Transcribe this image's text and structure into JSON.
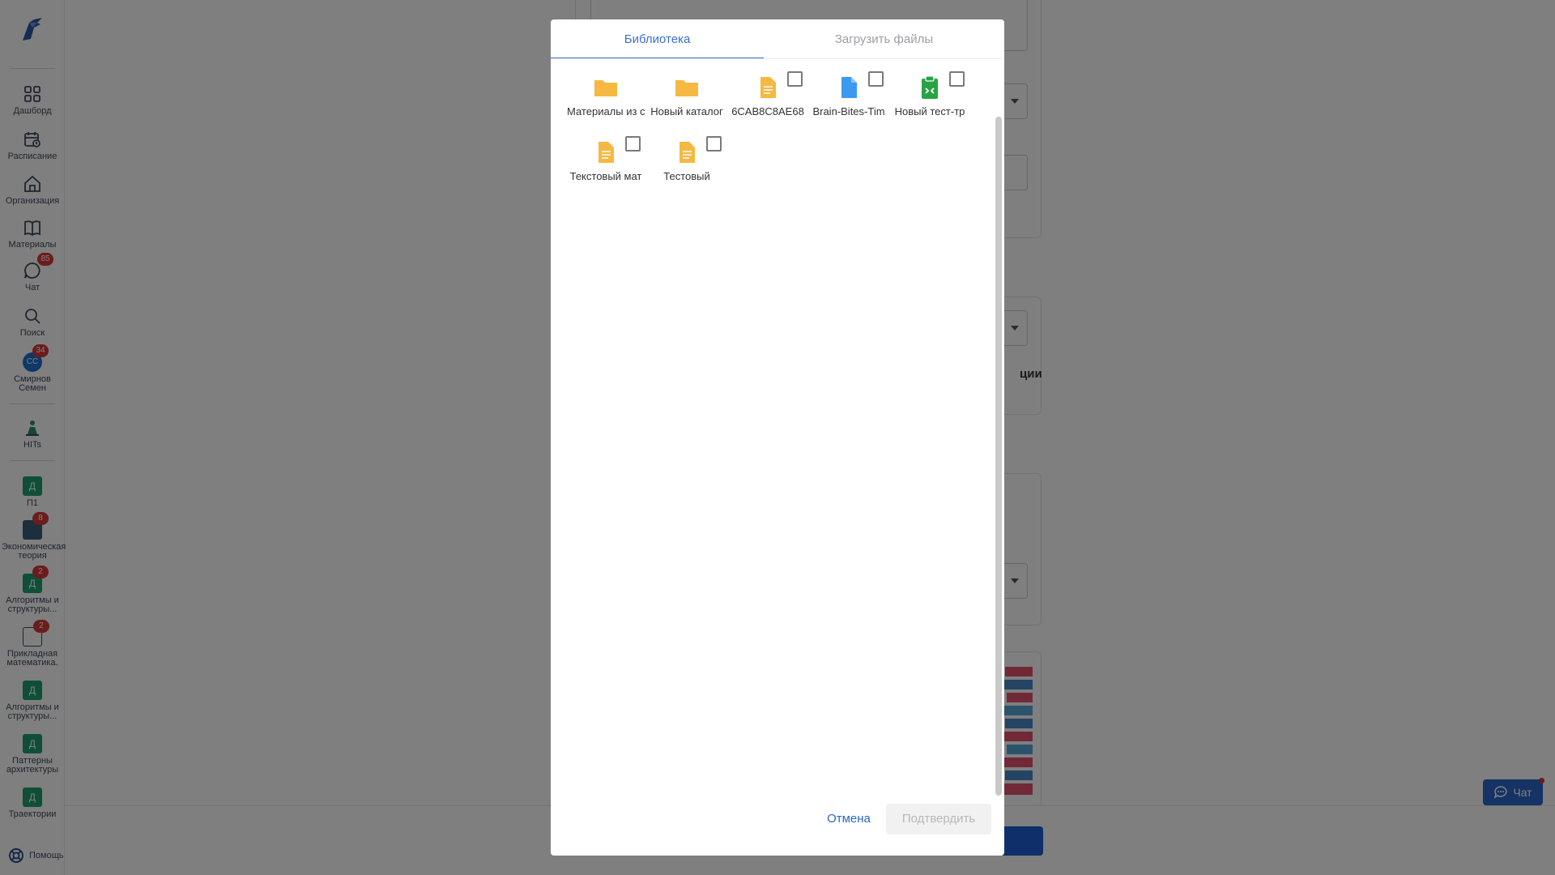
{
  "sidebar": {
    "nav": [
      {
        "label": "Дашборд",
        "icon": "dashboard-icon"
      },
      {
        "label": "Расписание",
        "icon": "calendar-icon"
      },
      {
        "label": "Организация",
        "icon": "home-icon"
      },
      {
        "label": "Материалы",
        "icon": "book-icon"
      },
      {
        "label": "Чат",
        "icon": "chat-icon",
        "badge": "85"
      },
      {
        "label": "Поиск",
        "icon": "search-icon"
      },
      {
        "label": "Смирнов Семен",
        "icon": "avatar",
        "avatar_text": "СС",
        "badge": "34"
      },
      {
        "label": "HITs",
        "icon": "hits-icon"
      }
    ],
    "courses": [
      {
        "label": "П1",
        "letter": "Д"
      },
      {
        "label": "Экономическая теория",
        "letter": "",
        "badge": "8"
      },
      {
        "label": "Алгоритмы и структуры...",
        "letter": "Д",
        "badge": "2"
      },
      {
        "label": "Прикладная математика.",
        "letter": "",
        "badge": "2"
      },
      {
        "label": "Алгоритмы и структуры...",
        "letter": "Д"
      },
      {
        "label": "Паттерны архитектуры",
        "letter": "Д"
      },
      {
        "label": "Траектории",
        "letter": "Д"
      }
    ],
    "help_label": "Помощь"
  },
  "background": {
    "visible_text": "ции",
    "chat_button_label": "Чат"
  },
  "modal": {
    "tabs": [
      {
        "label": "Библиотека",
        "active": true
      },
      {
        "label": "Загрузить файлы",
        "active": false
      }
    ],
    "items": [
      {
        "label": "Материалы из с",
        "type": "folder",
        "checkbox": false,
        "color": "#f5b841"
      },
      {
        "label": "Новый каталог",
        "type": "folder",
        "checkbox": false,
        "color": "#f5b841"
      },
      {
        "label": "6CAB8C8AE68",
        "type": "text-doc",
        "checkbox": true,
        "color": "#f5b841"
      },
      {
        "label": "Brain-Bites-Tim",
        "type": "file",
        "checkbox": true,
        "color": "#3b9af0"
      },
      {
        "label": "Новый тест-тр",
        "type": "test",
        "checkbox": true,
        "color": "#27a344"
      },
      {
        "label": "Текстовый мат",
        "type": "text-doc",
        "checkbox": true,
        "color": "#f5b841"
      },
      {
        "label": "Тестовый",
        "type": "text-doc",
        "checkbox": true,
        "color": "#f5b841"
      }
    ],
    "cancel_label": "Отмена",
    "confirm_label": "Подтвердить"
  },
  "colors": {
    "accent": "#3b6fd4",
    "folder": "#f5b841",
    "file_blue": "#3b9af0",
    "test_green": "#27a344",
    "badge": "#d93838"
  }
}
